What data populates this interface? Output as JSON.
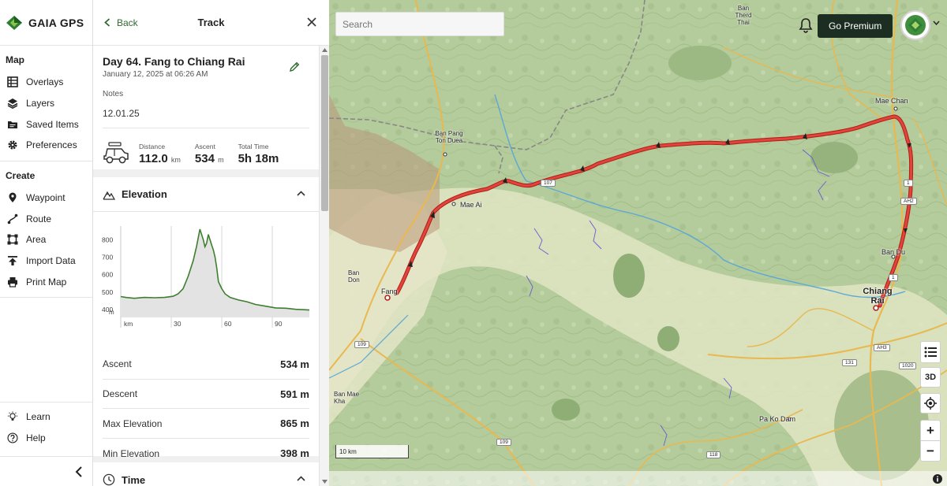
{
  "brand": {
    "name": "GAIA GPS"
  },
  "nav": {
    "map_heading": "Map",
    "map_items": [
      "Overlays",
      "Layers",
      "Saved Items",
      "Preferences"
    ],
    "create_heading": "Create",
    "create_items": [
      "Waypoint",
      "Route",
      "Area",
      "Import Data",
      "Print Map"
    ],
    "bottom_items": [
      "Learn",
      "Help"
    ]
  },
  "panel": {
    "back_label": "Back",
    "title": "Track",
    "track": {
      "name": "Day 64. Fang to Chiang Rai",
      "date": "January 12, 2025 at 06:26 AM",
      "notes_label": "Notes",
      "notes": "12.01.25"
    },
    "stats": {
      "distance_label": "Distance",
      "distance_value": "112.0",
      "distance_unit": "km",
      "ascent_label": "Ascent",
      "ascent_value": "534",
      "ascent_unit": "m",
      "time_label": "Total Time",
      "time_value": "5h 18m"
    },
    "elevation": {
      "title": "Elevation",
      "rows": [
        {
          "label": "Ascent",
          "value": "534 m"
        },
        {
          "label": "Descent",
          "value": "591 m"
        },
        {
          "label": "Max Elevation",
          "value": "865 m"
        },
        {
          "label": "Min Elevation",
          "value": "398 m"
        }
      ]
    },
    "time_section": {
      "title": "Time"
    }
  },
  "chart_data": {
    "type": "area",
    "ylabel": "m",
    "xlabel": "km",
    "y_ticks": [
      400,
      500,
      600,
      700,
      800
    ],
    "x_ticks": [
      30,
      60,
      90
    ],
    "ylim": [
      360,
      860
    ],
    "xlim": [
      0,
      112
    ],
    "grid": true,
    "x": [
      0,
      3,
      8,
      14,
      20,
      26,
      31,
      34,
      37,
      40,
      43,
      45,
      47,
      49,
      50,
      51,
      52,
      53,
      54,
      55,
      56,
      57,
      58,
      60,
      62,
      65,
      70,
      75,
      80,
      86,
      92,
      98,
      104,
      108,
      112
    ],
    "values": [
      475,
      470,
      465,
      470,
      468,
      470,
      476,
      490,
      520,
      590,
      680,
      760,
      860,
      800,
      760,
      780,
      830,
      800,
      770,
      740,
      700,
      640,
      560,
      520,
      490,
      470,
      455,
      445,
      430,
      420,
      410,
      408,
      402,
      400,
      398
    ]
  },
  "map": {
    "search_placeholder": "Search",
    "premium_label": "Go Premium",
    "btn_3d": "3D",
    "scale_label": "10 km",
    "labels": [
      {
        "text": "Mae Chan"
      },
      {
        "text": "Chiang Rai"
      },
      {
        "text": "Mae Ai"
      },
      {
        "text": "Fang"
      },
      {
        "text": "Ban Du"
      },
      {
        "text": "Ban Pang Ton Duea"
      },
      {
        "text": "Ban Don"
      },
      {
        "text": "Ban Mae Kha"
      },
      {
        "text": "Pa Ko Dam"
      },
      {
        "text": "Ban Therd Thai"
      }
    ],
    "road_shields": [
      "107",
      "1",
      "AH2",
      "1",
      "109",
      "109",
      "118",
      "131",
      "1020",
      "AH3"
    ]
  },
  "colors": {
    "brand_green": "#2e7d32",
    "track_red": "#d9342b",
    "premium_bg": "#1c2e22",
    "map_green": "#a9c48f"
  }
}
